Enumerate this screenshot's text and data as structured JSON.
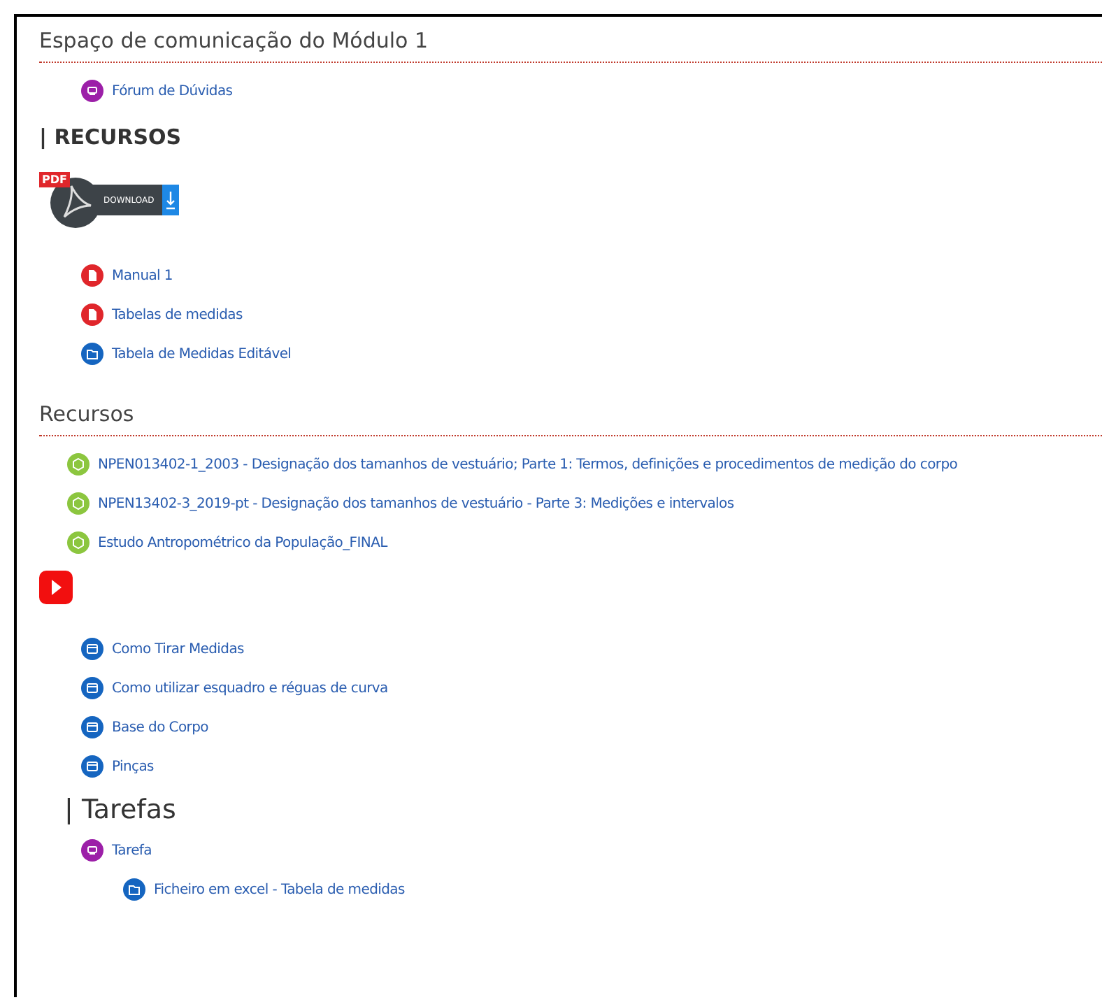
{
  "blocks": [
    {
      "kind": "section",
      "title": "Espaço de comunicação do Módulo 1"
    },
    {
      "kind": "forum",
      "label": "Fórum de Dúvidas"
    },
    {
      "kind": "caps_heading",
      "title": "| RECURSOS"
    },
    {
      "kind": "pdf_banner",
      "label": "DOWNLOAD",
      "badge": "PDF"
    },
    {
      "kind": "pdf",
      "label": "Manual 1"
    },
    {
      "kind": "pdf",
      "label": "Tabelas de medidas"
    },
    {
      "kind": "folder",
      "label": "Tabela de Medidas Editável"
    },
    {
      "kind": "section",
      "title": "Recursos"
    },
    {
      "kind": "package",
      "label": "NPEN013402-1_2003 - Designação dos tamanhos de vestuário; Parte 1: Termos, definições e procedimentos de medição do corpo"
    },
    {
      "kind": "package",
      "label": "NPEN13402-3_2019-pt - Designação dos tamanhos de vestuário - Parte 3: Medições e intervalos"
    },
    {
      "kind": "package",
      "label": "Estudo Antropométrico da População_FINAL"
    },
    {
      "kind": "video_banner"
    },
    {
      "kind": "page",
      "label": "Como Tirar Medidas"
    },
    {
      "kind": "page",
      "label": "Como utilizar esquadro e réguas de curva"
    },
    {
      "kind": "page",
      "label": "Base do Corpo"
    },
    {
      "kind": "page",
      "label": "Pinças"
    },
    {
      "kind": "large_heading",
      "title": "| Tarefas"
    },
    {
      "kind": "assign",
      "label": "Tarefa",
      "children": [
        {
          "kind": "folder",
          "label": "Ficheiro em excel - Tabela de medidas"
        }
      ]
    }
  ]
}
